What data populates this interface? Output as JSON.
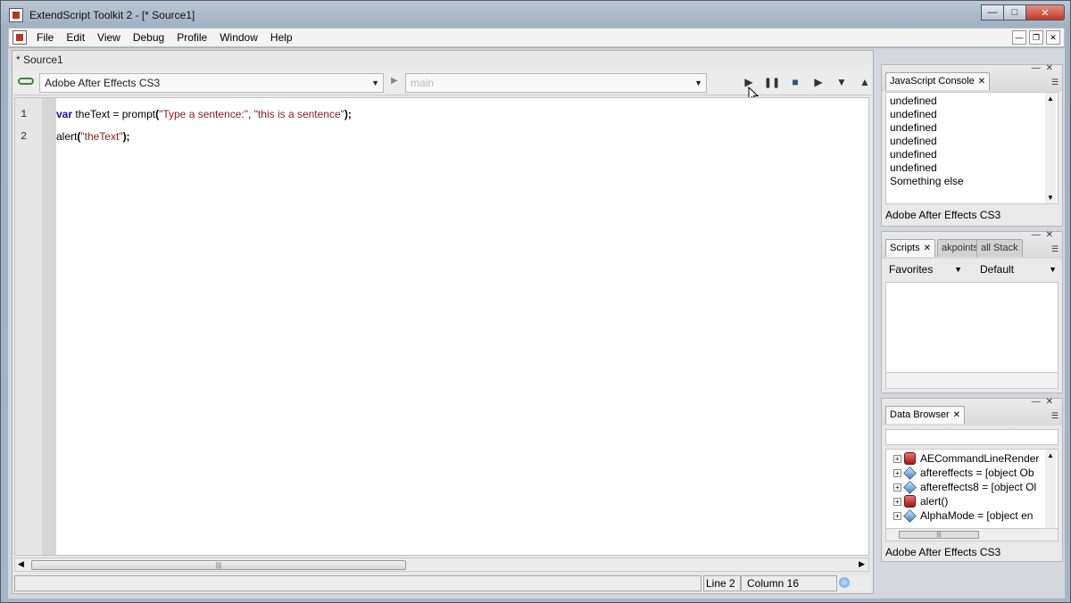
{
  "window": {
    "title": "ExtendScript Toolkit 2 - [* Source1]"
  },
  "menu": [
    "File",
    "Edit",
    "View",
    "Debug",
    "Profile",
    "Window",
    "Help"
  ],
  "editor": {
    "tab": "* Source1",
    "target_app": "Adobe After Effects CS3",
    "engine": "main",
    "lines": [
      {
        "no": "1",
        "kw": "var",
        "a": " theText = prompt",
        "p1": "(",
        "s1": "\"Type a sentence:\"",
        "b": ", ",
        "s2": "\"this is a sentence\"",
        "p2": ");"
      },
      {
        "no": "2",
        "fn": "alert",
        "p1": "(",
        "s1": "\"theText\"",
        "p2": ");"
      }
    ]
  },
  "status": {
    "line": "Line 2",
    "column": "Column 16"
  },
  "console": {
    "tab": "JavaScript Console",
    "lines": [
      "undefined",
      "undefined",
      "undefined",
      "undefined",
      "undefined",
      "undefined",
      "Something else"
    ],
    "footer": "Adobe After Effects CS3"
  },
  "scripts": {
    "tabs": [
      "Scripts",
      "akpoints",
      "all Stack"
    ],
    "favorites": "Favorites",
    "default": "Default"
  },
  "data_browser": {
    "tab": "Data Browser",
    "items": [
      {
        "label": "AECommandLineRender",
        "icon": "function-icon"
      },
      {
        "label": "aftereffects = [object Ob",
        "icon": "object-icon"
      },
      {
        "label": "aftereffects8 = [object Ol",
        "icon": "object-icon"
      },
      {
        "label": "alert()",
        "icon": "function-icon"
      },
      {
        "label": "AlphaMode = [object en",
        "icon": "object-icon"
      }
    ],
    "footer": "Adobe After Effects CS3"
  }
}
